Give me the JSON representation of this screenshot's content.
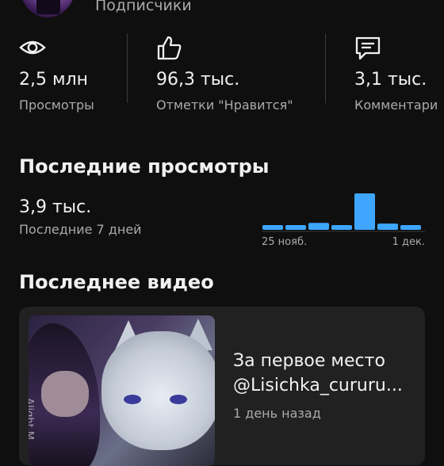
{
  "header": {
    "subscribers_label": "Подписчики"
  },
  "stats": [
    {
      "icon": "eye-icon",
      "value": "2,5 млн",
      "label": "Просмотры"
    },
    {
      "icon": "thumbs-up-icon",
      "value": "96,3 тыс.",
      "label": "Отметки \"Нравится\""
    },
    {
      "icon": "comment-icon",
      "value": "3,1 тыс.",
      "label": "Комментари"
    }
  ],
  "recent_views": {
    "title": "Последние просмотры",
    "value": "3,9 тыс.",
    "period_label": "Последние 7 дней",
    "x_start": "25 нояб.",
    "x_end": "1 дек.",
    "bar_color": "#3ea6ff",
    "bars": [
      0.13,
      0.13,
      0.19,
      0.13,
      1.0,
      0.17,
      0.13
    ]
  },
  "latest_video": {
    "section_title": "Последнее видео",
    "title_line1": "За первое место",
    "title_line2": "@Lisichka_cururu...",
    "age": "1 день назад",
    "watermark": "Alight M"
  }
}
